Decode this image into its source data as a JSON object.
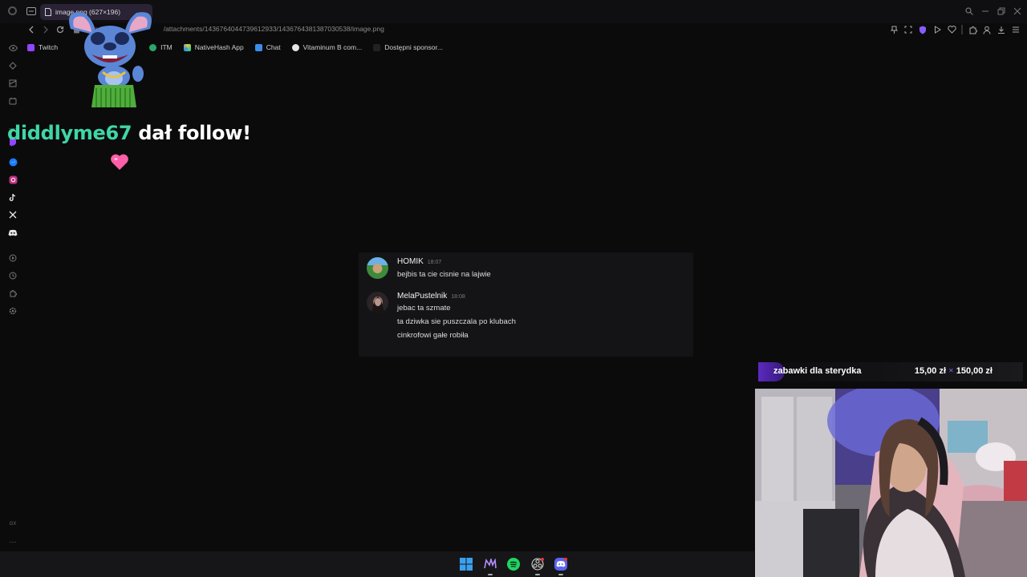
{
  "browser": {
    "tab_title": "image.png (627×196)",
    "url_host": "cdn",
    "url_path": "/attachments/1436764044739612933/1436764381387030538/image.png",
    "bookmarks": [
      {
        "label": "Twitch",
        "icon": "twitch-icon",
        "color": "#9146ff"
      },
      {
        "label": "ITM",
        "icon": "itm-icon",
        "color": "#2aa86b"
      },
      {
        "label": "NativeHash App",
        "icon": "nativehash-icon",
        "color": "#e8c244"
      },
      {
        "label": "Chat",
        "icon": "chat-icon",
        "color": "#3b8ee8"
      },
      {
        "label": "Vitaminum B com...",
        "icon": "vitamin-icon",
        "color": "#e6e6e6"
      },
      {
        "label": "Dostępni sponsor...",
        "icon": "sponsor-icon",
        "color": "#222"
      }
    ]
  },
  "alert": {
    "username": "diddlyme67",
    "message": " dał follow!",
    "accent": "#3fd6a6"
  },
  "discord": {
    "messages": [
      {
        "author": "HOMIK",
        "time": "18:07",
        "lines": [
          "bejbis ta cie cisnie na lajwie"
        ]
      },
      {
        "author": "MelaPustelnik",
        "time": "18:08",
        "lines": [
          "jebac ta szmate",
          "ta dziwka sie puszczala po klubach",
          "cinkrofowi gałe robiła"
        ]
      }
    ]
  },
  "goal": {
    "title": "zabawki dla sterydka",
    "current": "15,00 zł",
    "target": "150,00 zł",
    "progress": 0.1,
    "accent": "#6a2ee0"
  },
  "sidebar": {
    "bottom_label": "GX"
  },
  "taskbar": {
    "icons": [
      "windows-start-icon",
      "opera-gx-icon",
      "spotify-icon",
      "obs-icon",
      "discord-icon"
    ]
  }
}
